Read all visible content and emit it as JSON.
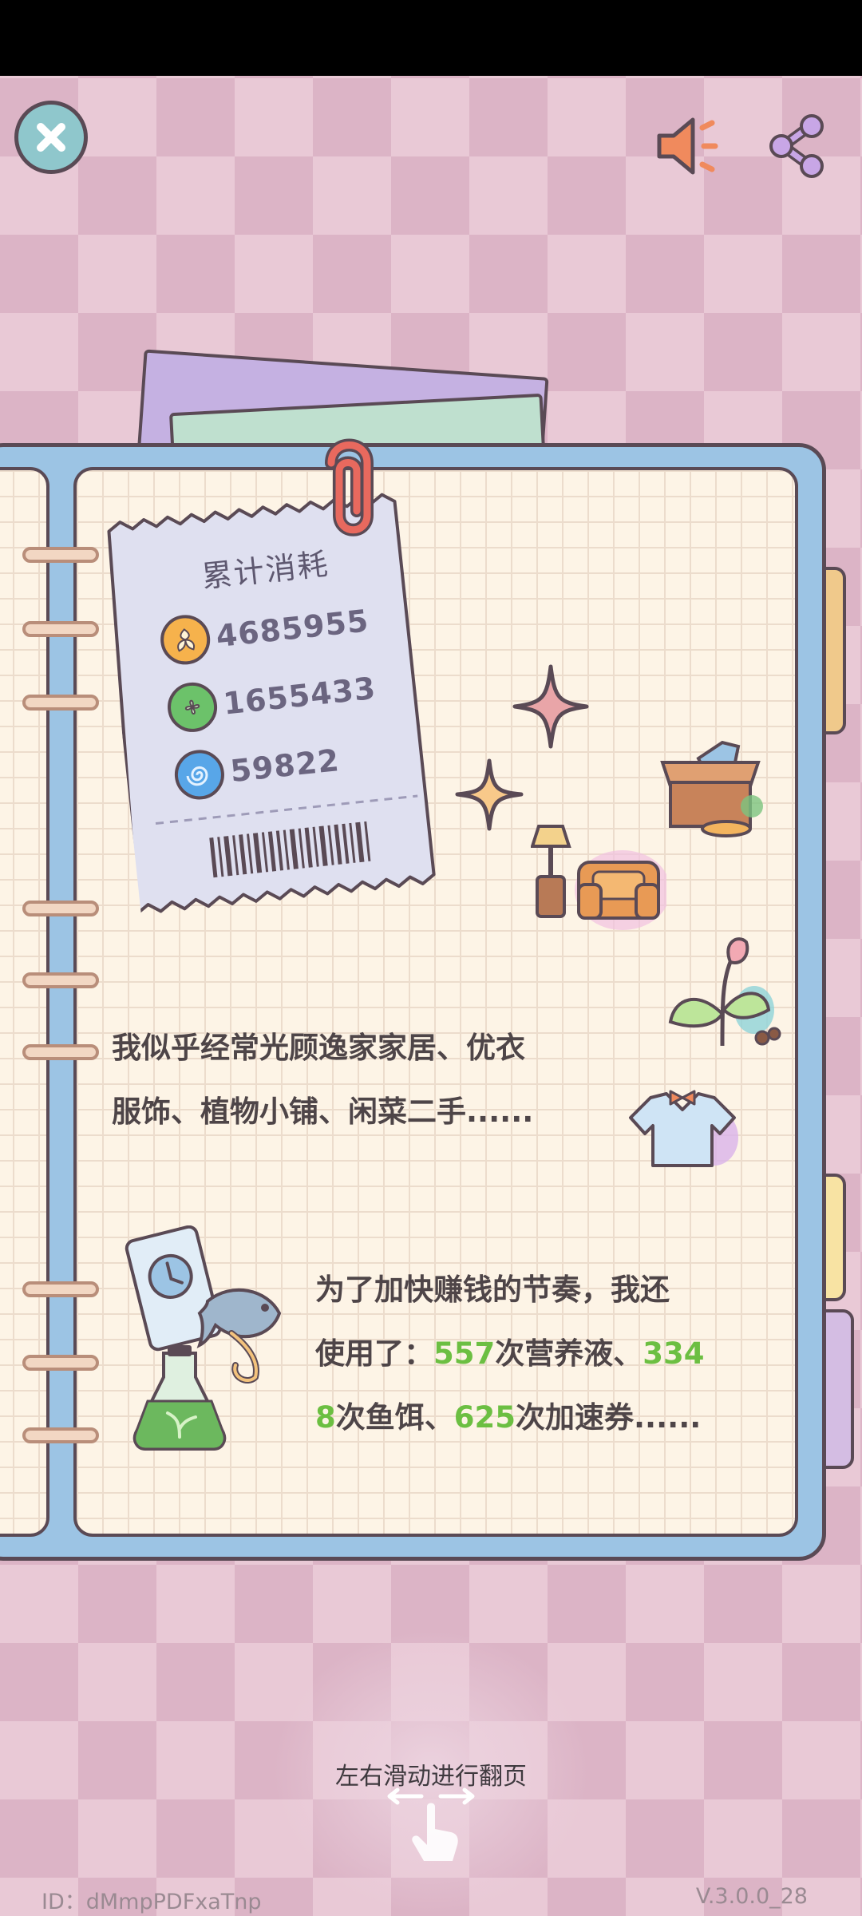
{
  "header": {
    "close_icon": "close-x-icon",
    "sound_icon": "speaker-icon",
    "share_icon": "share-icon"
  },
  "receipt": {
    "title": "累计消耗",
    "items": [
      {
        "icon": "gold-coin-icon",
        "value": "4685955",
        "color": "#f6b24c"
      },
      {
        "icon": "green-leaf-coin-icon",
        "value": "1655433",
        "color": "#6cc26a"
      },
      {
        "icon": "blue-swirl-coin-icon",
        "value": "59822",
        "color": "#58a6e8"
      }
    ]
  },
  "paragraph1": {
    "line1": "我似乎经常光顾逸家家居、优衣",
    "line2": "服饰、植物小铺、闲菜二手......"
  },
  "paragraph2": {
    "line1": "为了加快赚钱的节奏，我还",
    "line2_prefix": "使用了：",
    "line2_num1": "557",
    "line2_mid": "次营养液、",
    "line2_num2_part": "334",
    "line3_num2_rest": "8",
    "line3_mid": "次鱼饵、",
    "line3_num3": "625",
    "line3_suffix": "次加速券......"
  },
  "footer": {
    "hint": "左右滑动进行翻页",
    "id": "ID：dMmpPDFxaTnp",
    "version": "V.3.0.0_28"
  },
  "colors": {
    "highlight_green": "#6cbf42",
    "notebook_blue": "#9cc4e4",
    "page_cream": "#fdf4e6"
  }
}
